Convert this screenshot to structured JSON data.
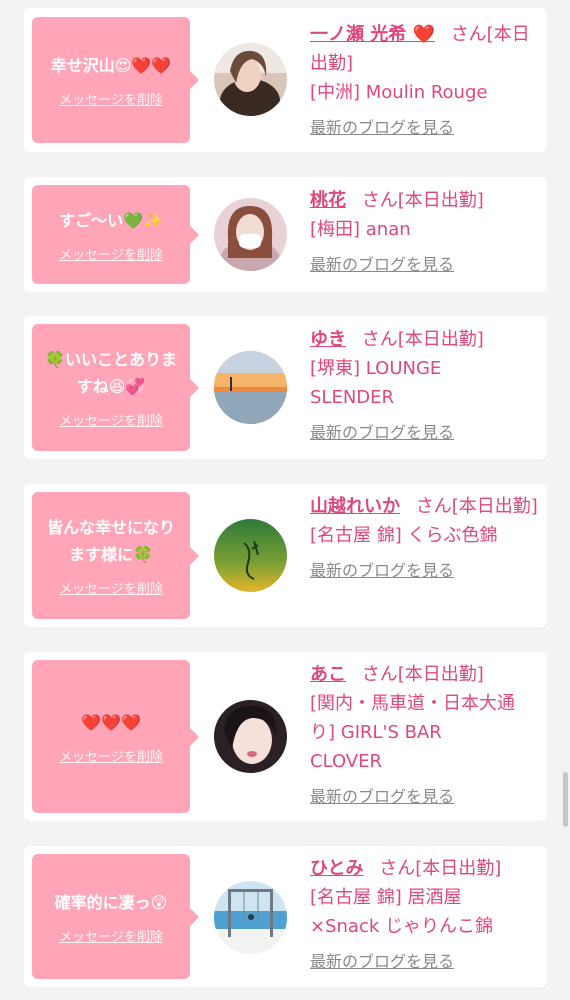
{
  "delete_label": "メッセージを削除",
  "blog_label": "最新のブログを見る",
  "suffix": "さん[本日出勤]",
  "accent_color": "#e0487c",
  "bubble_color": "#ffa5b7",
  "items": [
    {
      "message": "幸せ沢山😍❤️❤️",
      "name": "一ノ瀬 光希 ❤️",
      "shop": "[中洲] Moulin Rouge",
      "avatar_icon": "woman-selfie-photo"
    },
    {
      "message": "すご〜い💚✨",
      "name": "桃花",
      "shop": "[梅田] anan",
      "avatar_icon": "woman-mask-photo"
    },
    {
      "message": "🍀いいことありま\nすね😆💞",
      "name": "ゆき",
      "shop": "[堺東] LOUNGE\nSLENDER",
      "avatar_icon": "sunset-beach-photo"
    },
    {
      "message": "皆んな幸せになり\nます様に🍀",
      "name": "山越れいか",
      "shop": "[名古屋 錦] くらぶ色錦",
      "avatar_icon": "green-logo-photo"
    },
    {
      "message": "❤️❤️❤️",
      "name": "あこ",
      "shop": "[関内・馬車道・日本大通\nり] GIRL'S BAR\nCLOVER",
      "avatar_icon": "woman-closeup-photo"
    },
    {
      "message": "確率的に凄っ😲",
      "name": "ひとみ",
      "shop": "[名古屋 錦] 居酒屋\n×Snack じゃりんこ錦",
      "avatar_icon": "swing-ocean-photo"
    }
  ]
}
